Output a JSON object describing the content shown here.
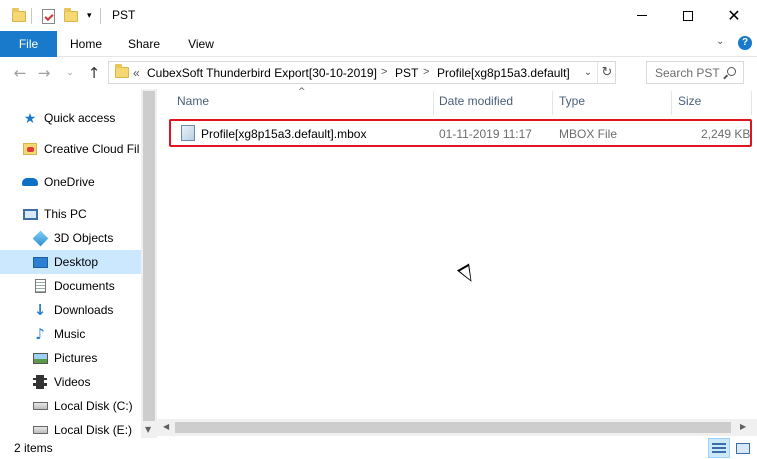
{
  "window": {
    "title": "PST",
    "controls": {
      "minimize": "—",
      "maximize": "☐",
      "close": "✕"
    }
  },
  "ribbon": {
    "tabs": [
      {
        "label": "File"
      },
      {
        "label": "Home"
      },
      {
        "label": "Share"
      },
      {
        "label": "View"
      }
    ],
    "help": "?"
  },
  "address": {
    "overflow": "«",
    "breadcrumbs": [
      "CubexSoft Thunderbird Export[30-10-2019]",
      "PST",
      "Profile[xg8p15a3.default]"
    ],
    "search_placeholder": "Search PST"
  },
  "nav_pane": {
    "items": [
      {
        "label": "Quick access",
        "icon": "star-icon",
        "level": 0
      },
      {
        "label": "Creative Cloud Fil",
        "icon": "creative-cloud-folder-icon",
        "level": 0
      },
      {
        "label": "OneDrive",
        "icon": "cloud-icon",
        "level": 0
      },
      {
        "label": "This PC",
        "icon": "computer-icon",
        "level": 0
      },
      {
        "label": "3D Objects",
        "icon": "cube-icon",
        "level": 1
      },
      {
        "label": "Desktop",
        "icon": "desktop-icon",
        "level": 1,
        "selected": true
      },
      {
        "label": "Documents",
        "icon": "documents-icon",
        "level": 1
      },
      {
        "label": "Downloads",
        "icon": "download-arrow-icon",
        "level": 1
      },
      {
        "label": "Music",
        "icon": "music-note-icon",
        "level": 1
      },
      {
        "label": "Pictures",
        "icon": "pictures-icon",
        "level": 1
      },
      {
        "label": "Videos",
        "icon": "film-icon",
        "level": 1
      },
      {
        "label": "Local Disk (C:)",
        "icon": "drive-icon",
        "level": 1
      },
      {
        "label": "Local Disk (E:)",
        "icon": "drive-icon",
        "level": 1
      }
    ]
  },
  "file_list": {
    "columns": [
      "Name",
      "Date modified",
      "Type",
      "Size"
    ],
    "rows": [
      {
        "name": "Profile[xg8p15a3.default].mbox",
        "date_modified": "01-11-2019 11:17",
        "type": "MBOX File",
        "size": "2,249 KB",
        "icon": "mbox-file-icon",
        "highlighted": true
      }
    ]
  },
  "status": {
    "item_count": "2 items"
  },
  "colors": {
    "accent": "#1979ca",
    "selection": "#cce8ff",
    "highlight_border": "#e0141e"
  }
}
